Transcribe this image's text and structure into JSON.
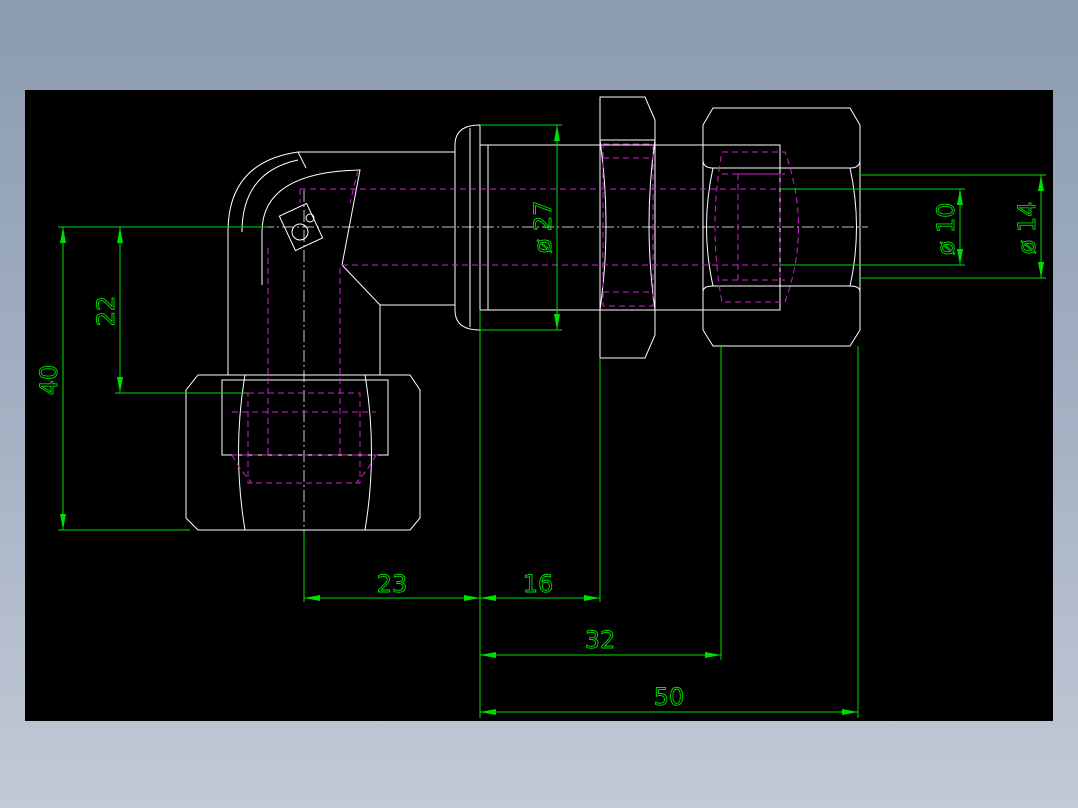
{
  "dimensions": {
    "d23": "23",
    "d16": "16",
    "d32": "32",
    "d50": "50",
    "d22": "22",
    "d40": "40",
    "dia27": "ø 27",
    "dia10": "ø 10",
    "dia14": "ø 14"
  },
  "colors": {
    "background": "#000000",
    "outline": "#ffffff",
    "hidden_lines": "#d020d0",
    "dimension_lines": "#00dd00",
    "window_bg": "#8b9bb0"
  }
}
